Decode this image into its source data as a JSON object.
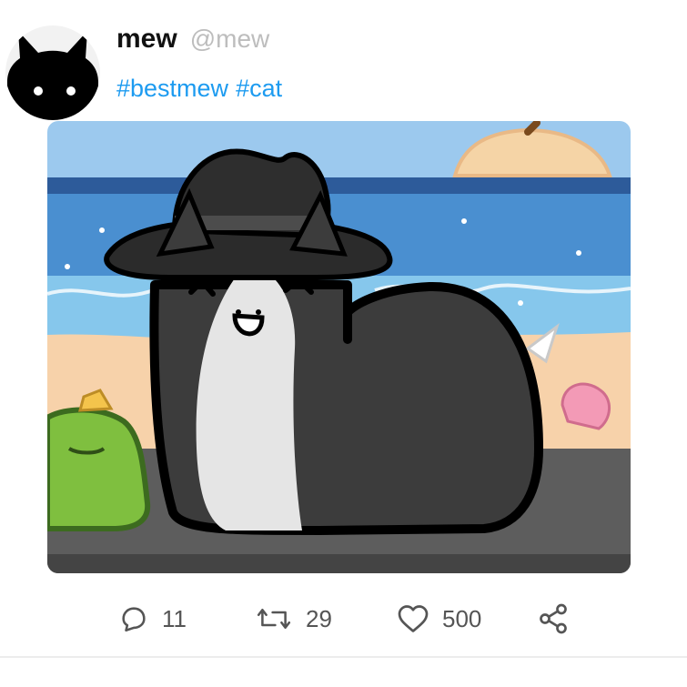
{
  "author": {
    "display_name": "mew",
    "handle": "@mew",
    "avatar_icon": "black-cat-avatar"
  },
  "tweet": {
    "hashtags": [
      "#bestmew",
      "#cat"
    ],
    "media_icon": "cat-in-hat-beach-illustration"
  },
  "actions": {
    "reply": {
      "icon": "reply-icon",
      "count": "11"
    },
    "retweet": {
      "icon": "retweet-icon",
      "count": "29"
    },
    "like": {
      "icon": "heart-icon",
      "count": "500"
    },
    "share": {
      "icon": "share-icon"
    }
  },
  "colors": {
    "accent": "#1d9bf0",
    "muted": "#bdbdbd"
  }
}
